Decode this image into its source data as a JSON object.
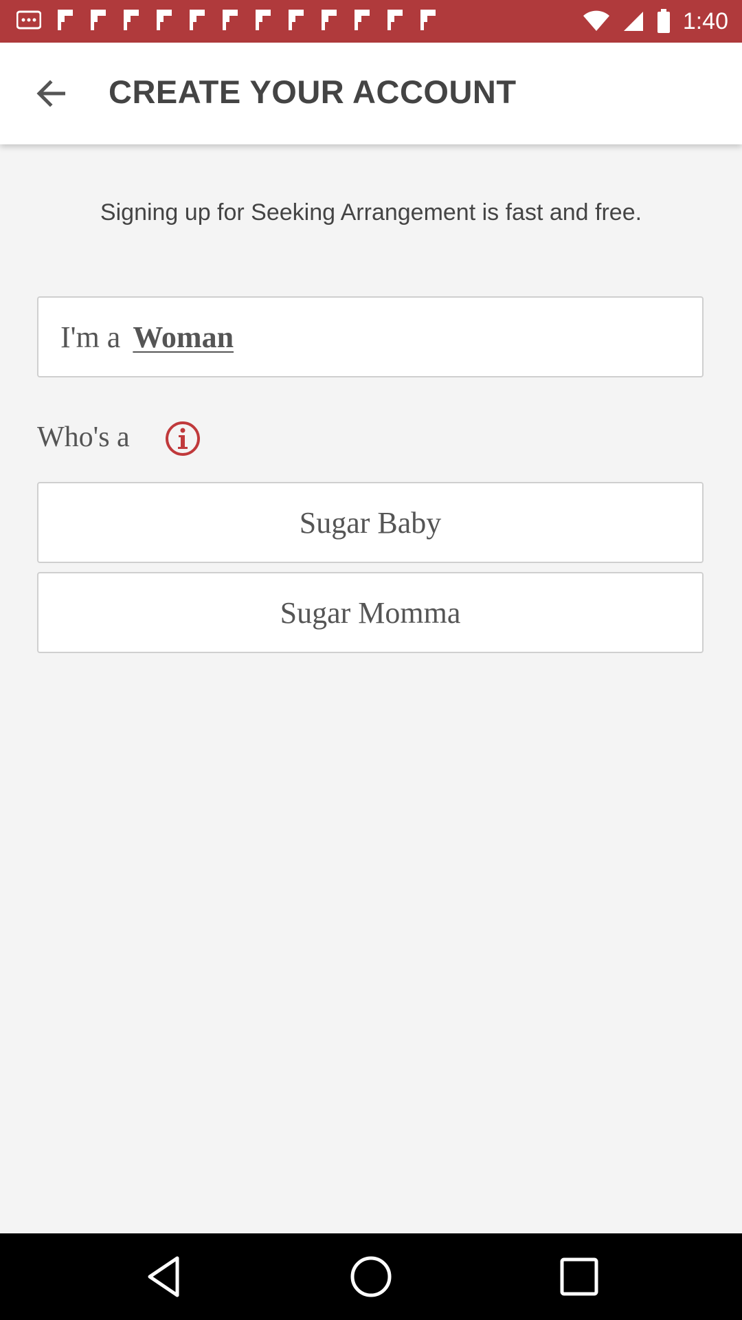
{
  "status_bar": {
    "time": "1:40",
    "color": "#b03a3c",
    "notification_icons": [
      "more-icon",
      "flipboard-icon",
      "flipboard-icon",
      "flipboard-icon",
      "flipboard-icon",
      "flipboard-icon",
      "flipboard-icon",
      "flipboard-icon",
      "flipboard-icon",
      "flipboard-icon",
      "flipboard-icon",
      "flipboard-icon",
      "flipboard-icon"
    ],
    "system_icons": [
      "wifi-icon",
      "signal-icon",
      "battery-icon"
    ]
  },
  "app_bar": {
    "back_icon": "arrow-back-icon",
    "title": "CREATE YOUR ACCOUNT"
  },
  "intro": {
    "text": "Signing up for Seeking Arrangement is fast and free."
  },
  "gender": {
    "label": "I'm a",
    "value": "Woman"
  },
  "role": {
    "label": "Who's a",
    "info_icon": "info-icon",
    "info_icon_color": "#c0393b",
    "options": [
      {
        "label": "Sugar Baby"
      },
      {
        "label": "Sugar Momma"
      }
    ]
  },
  "nav_bar": {
    "buttons": [
      "back-nav-icon",
      "home-nav-icon",
      "recents-nav-icon"
    ]
  }
}
